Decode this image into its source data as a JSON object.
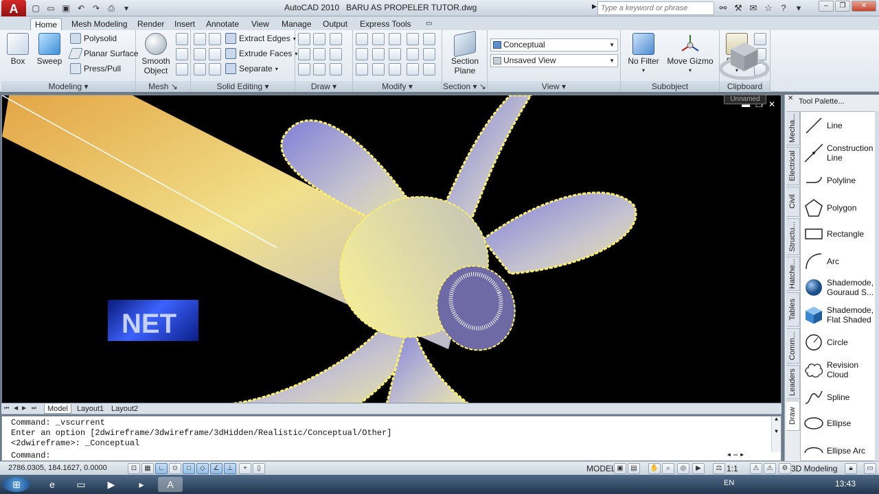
{
  "titlebar": {
    "app_name": "AutoCAD 2010",
    "file_name": "BARU AS PROPELER TUTOR.dwg",
    "search_placeholder": "Type a keyword or phrase"
  },
  "tabs": [
    "Home",
    "Mesh Modeling",
    "Render",
    "Insert",
    "Annotate",
    "View",
    "Manage",
    "Output",
    "Express Tools"
  ],
  "ribbon": {
    "modeling": {
      "title": "Modeling",
      "box": "Box",
      "sweep": "Sweep",
      "polysolid": "Polysolid",
      "planar_surface": "Planar Surface",
      "press_pull": "Press/Pull"
    },
    "mesh": {
      "title": "Mesh",
      "smooth_object_1": "Smooth",
      "smooth_object_2": "Object"
    },
    "solid_editing": {
      "title": "Solid Editing",
      "extract_edges": "Extract Edges",
      "extrude_faces": "Extrude Faces",
      "separate": "Separate"
    },
    "draw": {
      "title": "Draw"
    },
    "modify": {
      "title": "Modify"
    },
    "section": {
      "title": "Section",
      "section_plane_1": "Section",
      "section_plane_2": "Plane"
    },
    "view": {
      "title": "View",
      "visual_style": "Conceptual",
      "named_view": "Unsaved View"
    },
    "subobject": {
      "title": "Subobject",
      "no_filter": "No Filter",
      "move_gizmo": "Move Gizmo"
    },
    "clipboard": {
      "title": "Clipboard",
      "paste": "Paste"
    }
  },
  "viewport": {
    "viewcube_label": "Unnamed"
  },
  "layout_tabs": [
    "Model",
    "Layout1",
    "Layout2"
  ],
  "command_line": {
    "line1": "Command: _vscurrent",
    "line2": "Enter an option [2dwireframe/3dwireframe/3dHidden/Realistic/Conceptual/Other]",
    "line3": "<2dwireframe>: _Conceptual",
    "prompt": "Command:"
  },
  "statusbar": {
    "coords": "2786.0305, 184.1627, 0.0000",
    "model": "MODEL",
    "scale": "1:1",
    "workspace": "3D Modeling"
  },
  "palette": {
    "title": "Tool Palette...",
    "vtabs": [
      "Mecha...",
      "Electrical",
      "Civil",
      "Structu...",
      "Hatche...",
      "Tables",
      "Comm...",
      "Leaders",
      "Draw"
    ],
    "items": [
      "Line",
      "Construction Line",
      "Polyline",
      "Polygon",
      "Rectangle",
      "Arc",
      "Shademode, Gouraud S...",
      "Shademode, Flat Shaded",
      "Circle",
      "Revision Cloud",
      "Spline",
      "Ellipse",
      "Ellipse Arc"
    ]
  },
  "taskbar": {
    "lang": "EN",
    "time": "13:43"
  }
}
